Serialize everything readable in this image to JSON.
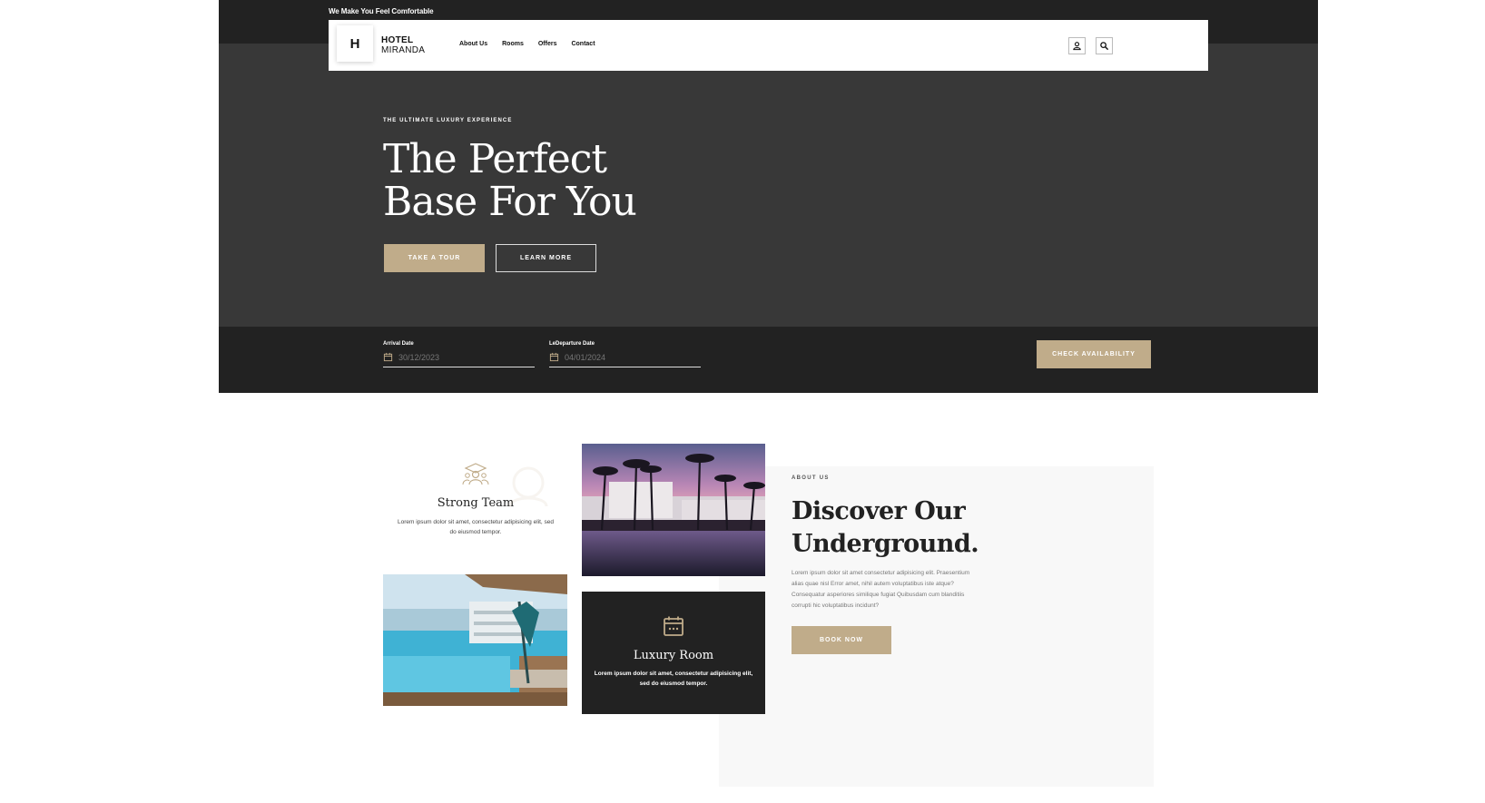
{
  "header": {
    "tagline": "We Make You Feel Comfortable",
    "logo_letter": "H",
    "brand_line1": "HOTEL",
    "brand_line2": "MIRANDA",
    "nav": [
      "About Us",
      "Rooms",
      "Offers",
      "Contact"
    ],
    "icons": [
      "user-icon",
      "search-icon"
    ]
  },
  "hero": {
    "eyebrow": "THE ULTIMATE LUXURY EXPERIENCE",
    "title_line1": "The Perfect",
    "title_line2": "Base For You",
    "primary_button": "TAKE A TOUR",
    "secondary_button": "LEARN MORE"
  },
  "booking": {
    "arrival_label": "Arrival Date",
    "arrival_value": "30/12/2023",
    "departure_label": "LeDeparture Date",
    "departure_value": "04/01/2024",
    "check_button": "CHECK AVAILABILITY"
  },
  "features": {
    "strong_team": {
      "title": "Strong Team",
      "text": "Lorem ipsum dolor sit amet, consectetur adipisicing elit, sed do eiusmod tempor."
    },
    "luxury_room": {
      "title": "Luxury Room",
      "text": "Lorem ipsum dolor sit amet, consectetur adipisicing elit, sed do eiusmod tempor."
    }
  },
  "about": {
    "eyebrow": "ABOUT US",
    "title_line1": "Discover Our",
    "title_line2": "Underground.",
    "text": "Lorem ipsum dolor sit amet consectetur adipisicing elit. Praesentium alias quae nisl Error amet, nihil autem voluptatibus iste atque? Consequatur asperiores similique fugiat Quibusdam cum blanditiis corrupti hic voluptatibus incidunt?",
    "button": "BOOK NOW"
  },
  "colors": {
    "accent": "#c0ac8a",
    "dark": "#222222",
    "hero_bg": "#383838"
  }
}
